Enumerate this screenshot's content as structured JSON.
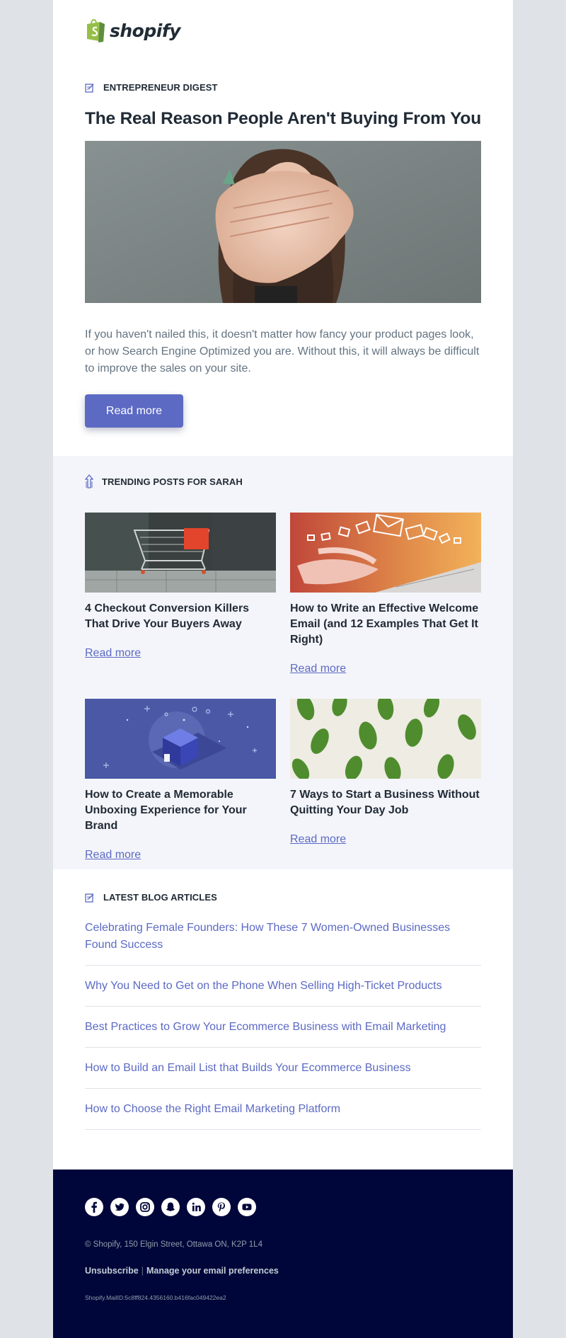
{
  "brand": {
    "name": "shopify",
    "accent": "#5c6ac4",
    "logo_green": "#95bf47"
  },
  "hero": {
    "section_label": "ENTREPRENEUR DIGEST",
    "title": "The Real Reason People Aren't Buying From You",
    "body": "If you haven't nailed this, it doesn't matter how fancy your product pages look, or how Search Engine Optimized you are. Without this, it will always be difficult to improve the sales on your site.",
    "button_label": "Read more"
  },
  "trending": {
    "section_label": "TRENDING POSTS FOR SARAH",
    "cards": [
      {
        "title": "4 Checkout Conversion Killers That Drive Your Buyers Away",
        "link": "Read more"
      },
      {
        "title": "How to Write an Effective Welcome Email (and 12 Examples That Get It Right)",
        "link": "Read more"
      },
      {
        "title": "How to Create a Memorable Unboxing Experience for Your Brand",
        "link": "Read more"
      },
      {
        "title": "7 Ways to Start a Business Without Quitting Your Day Job",
        "link": "Read more"
      }
    ]
  },
  "latest": {
    "section_label": "LATEST BLOG ARTICLES",
    "articles": [
      "Celebrating Female Founders: How These 7 Women-Owned Businesses Found Success",
      "Why You Need to Get on the Phone When Selling High-Ticket Products",
      "Best Practices to Grow Your Ecommerce Business with Email Marketing",
      "How to Build an Email List that Builds Your Ecommerce Business",
      "How to Choose the Right Email Marketing Platform"
    ]
  },
  "footer": {
    "socials": [
      "facebook-icon",
      "twitter-icon",
      "instagram-icon",
      "snapchat-icon",
      "linkedin-icon",
      "pinterest-icon",
      "youtube-icon"
    ],
    "address": "© Shopify,  150 Elgin Street, Ottawa ON, K2P 1L4",
    "unsubscribe": "Unsubscribe",
    "separator": "|",
    "manage_prefs": "Manage your email preferences",
    "mail_id": "Shopify.MailID:5c8ff824.4356160.b416fac049422ea2"
  }
}
